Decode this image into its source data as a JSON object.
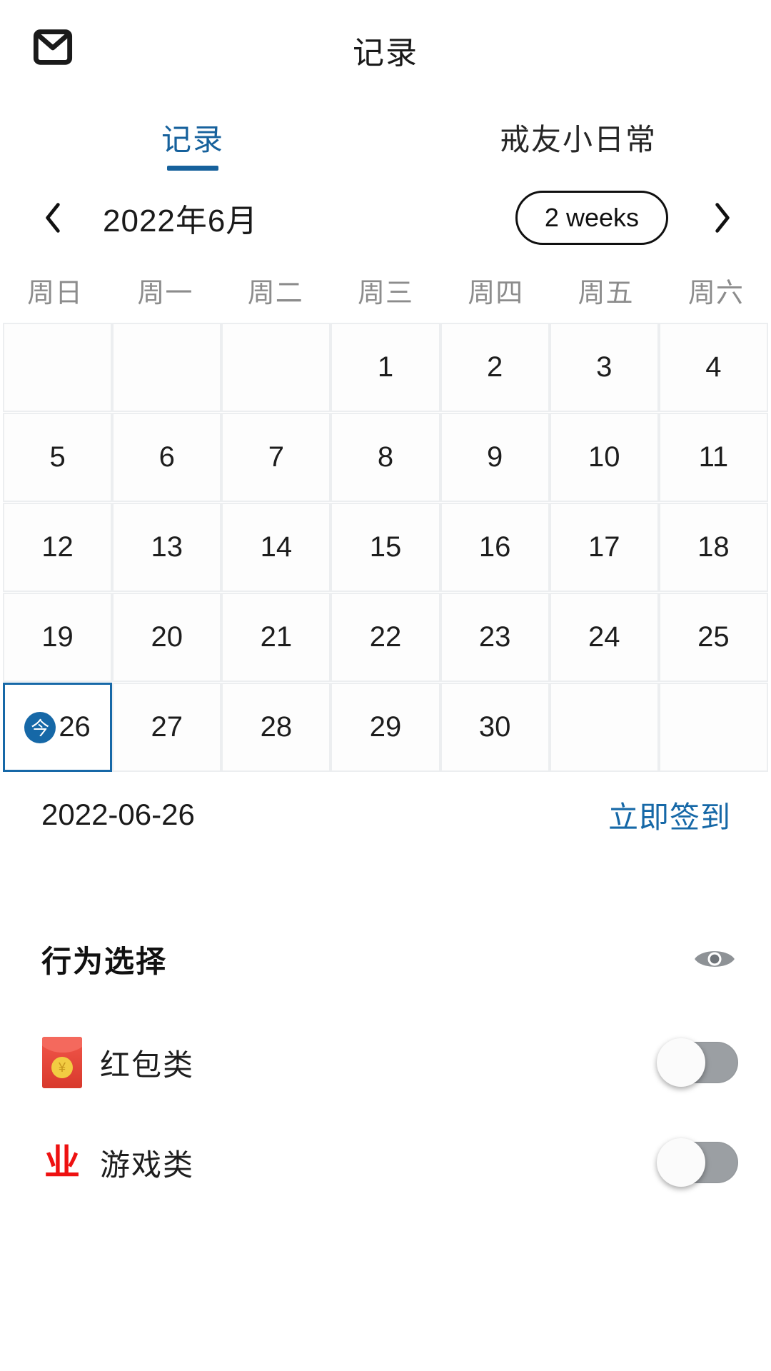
{
  "header": {
    "mail_icon": "mail-icon",
    "title": "记录"
  },
  "tabs": [
    {
      "label": "记录",
      "active": true
    },
    {
      "label": "戒友小日常",
      "active": false
    }
  ],
  "calendar_nav": {
    "prev_icon": "chevron-left-icon",
    "next_icon": "chevron-right-icon",
    "month_label": "2022年6月",
    "range_toggle_label": "2 weeks"
  },
  "weekdays": [
    "周日",
    "周一",
    "周二",
    "周三",
    "周四",
    "周五",
    "周六"
  ],
  "calendar": {
    "today_badge": "今",
    "today_day": "26",
    "weeks": [
      [
        "",
        "",
        "",
        "1",
        "2",
        "3",
        "4"
      ],
      [
        "5",
        "6",
        "7",
        "8",
        "9",
        "10",
        "11"
      ],
      [
        "12",
        "13",
        "14",
        "15",
        "16",
        "17",
        "18"
      ],
      [
        "19",
        "20",
        "21",
        "22",
        "23",
        "24",
        "25"
      ],
      [
        "26",
        "27",
        "28",
        "29",
        "30",
        "",
        ""
      ]
    ]
  },
  "selected_date": {
    "date_text": "2022-06-26",
    "checkin_label": "立即签到"
  },
  "behaviour_section": {
    "title": "行为选择",
    "eye_icon": "eye-icon",
    "items": [
      {
        "icon": "red-packet-icon",
        "label": "红包类",
        "enabled": false
      },
      {
        "icon": "fire-icon",
        "label": "游戏类",
        "enabled": false
      }
    ]
  },
  "colors": {
    "accent_blue": "#1668a7",
    "tab_active": "#16619c",
    "cell_border": "#eceef0",
    "weekday_gray": "#8c8c8c",
    "toggle_off": "#9b9fa3",
    "red_packet": "#d8392c"
  }
}
